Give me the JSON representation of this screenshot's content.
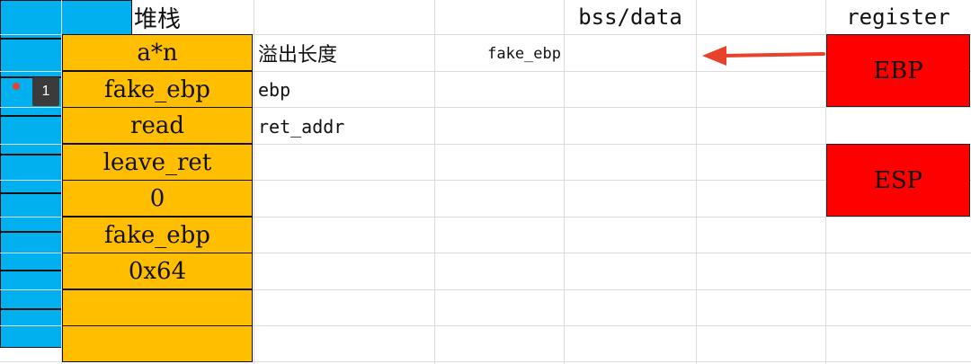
{
  "headers": {
    "stack": "堆栈",
    "bss_data": "bss/data",
    "register": "register"
  },
  "stack_cells": [
    "a*n",
    "fake_ebp",
    "read",
    "leave_ret",
    "0",
    "fake_ebp",
    "0x64",
    "",
    ""
  ],
  "notes": {
    "row1": "溢出长度",
    "row2": "ebp",
    "row3": "ret_addr"
  },
  "bss_label": "fake_ebp",
  "registers": {
    "ebp": "EBP",
    "esp": "ESP"
  },
  "comment_badge": "1",
  "colors": {
    "stack_fill": "#ffbf00",
    "bss_fill": "#00b0ef",
    "register_fill": "#ff0000",
    "arrow": "#e8412c"
  }
}
